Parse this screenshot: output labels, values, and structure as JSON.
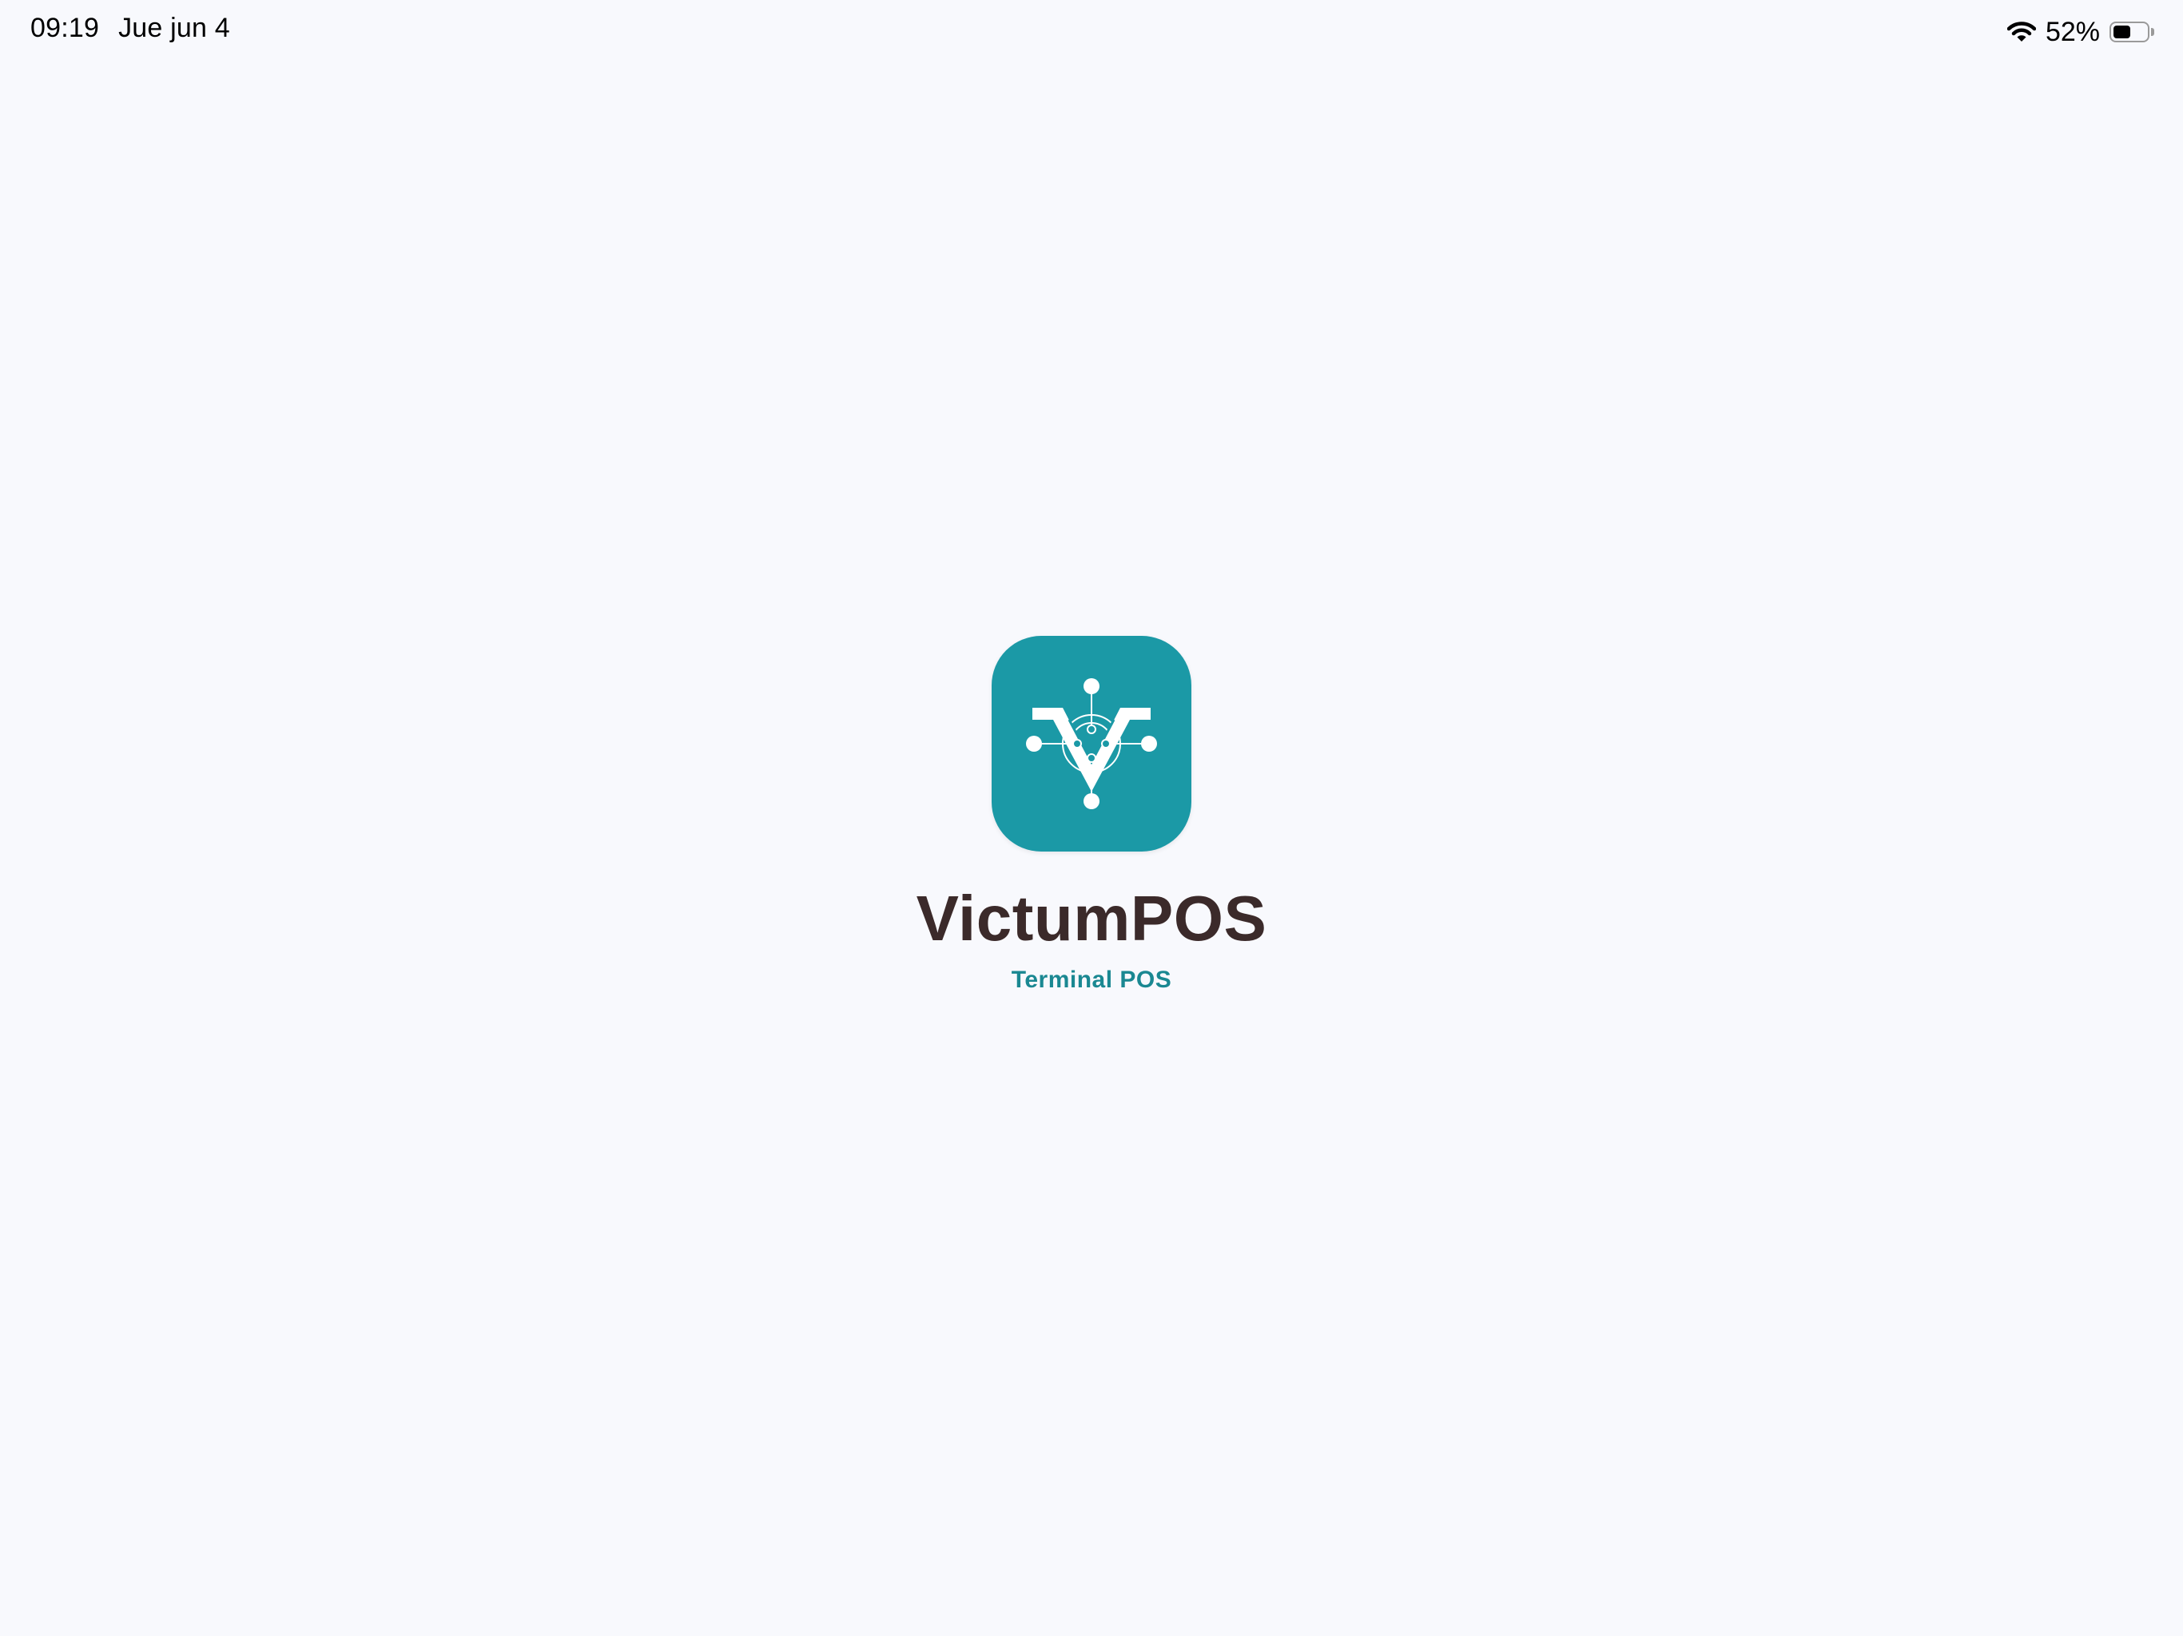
{
  "status_bar": {
    "time": "09:19",
    "date": "Jue jun 4",
    "battery_percent_label": "52%",
    "battery_level": 0.52,
    "wifi_icon": "wifi-icon",
    "battery_icon": "battery-icon"
  },
  "splash": {
    "logo_icon": "victumpos-logo-icon",
    "app_name": "VictumPOS",
    "subtitle": "Terminal POS"
  },
  "colors": {
    "background": "#f8f9fd",
    "icon_background": "#1b99a6",
    "app_name": "#3b2a2a",
    "subtitle": "#1a8892"
  }
}
